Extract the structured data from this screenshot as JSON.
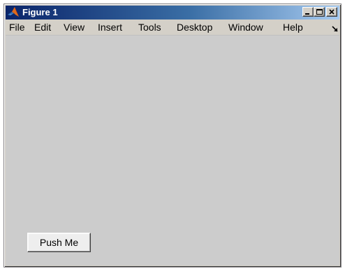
{
  "window": {
    "title": "Figure 1",
    "app_icon": "matlab-membrane-icon",
    "controls": [
      "minimize-icon",
      "maximize-icon",
      "close-icon"
    ]
  },
  "menubar": {
    "items": [
      {
        "label": "File"
      },
      {
        "label": "Edit"
      },
      {
        "label": "View"
      },
      {
        "label": "Insert"
      },
      {
        "label": "Tools"
      },
      {
        "label": "Desktop"
      },
      {
        "label": "Window"
      },
      {
        "label": "Help"
      }
    ],
    "dock_icon": "dock-arrow-icon"
  },
  "figure": {
    "background": "#cccccc",
    "push_button_label": "Push Me"
  },
  "colors": {
    "titlebar_start": "#0a246a",
    "titlebar_end": "#a6caf0",
    "chrome": "#d4d0c8"
  }
}
